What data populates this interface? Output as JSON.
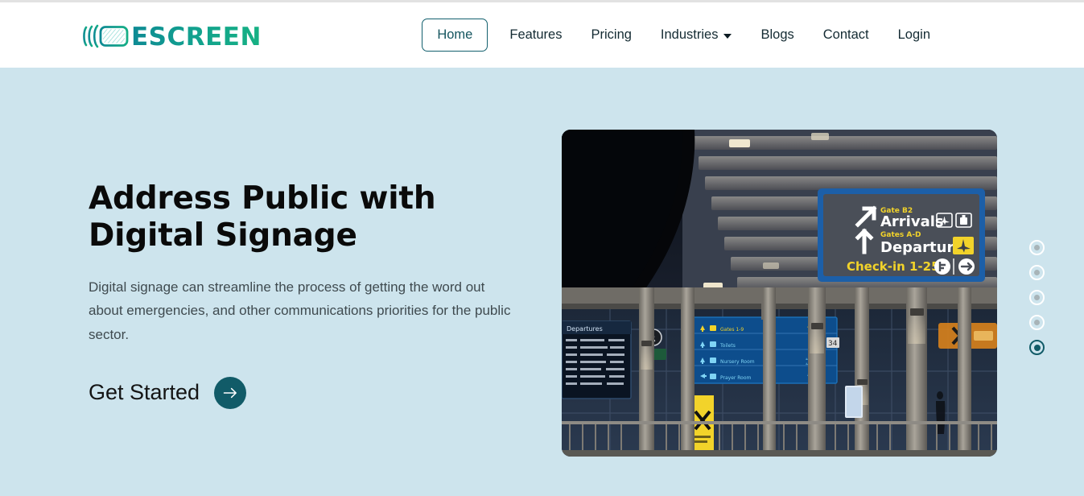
{
  "brand": {
    "name": "ESCREEN",
    "logo_icon": "screen-broadcast-icon",
    "gradient_from": "#0e8a94",
    "gradient_to": "#16b183"
  },
  "nav": {
    "items": [
      {
        "label": "Home",
        "active": true,
        "has_dropdown": false
      },
      {
        "label": "Features",
        "active": false,
        "has_dropdown": false
      },
      {
        "label": "Pricing",
        "active": false,
        "has_dropdown": false
      },
      {
        "label": "Industries",
        "active": false,
        "has_dropdown": true
      },
      {
        "label": "Blogs",
        "active": false,
        "has_dropdown": false
      },
      {
        "label": "Contact",
        "active": false,
        "has_dropdown": false
      },
      {
        "label": "Login",
        "active": false,
        "has_dropdown": false
      }
    ]
  },
  "hero": {
    "title": "Address Public with Digital Signage",
    "body": "Digital signage can streamline the process of getting the word out about emergencies, and other communications priorities for the public sector.",
    "cta_label": "Get Started",
    "cta_icon": "arrow-right-icon",
    "accent_color": "#115b68",
    "background_color": "#cde4ed"
  },
  "hero_image": {
    "alt": "Airport terminal at night with digital wayfinding signage",
    "sign": {
      "arrivals_gate": "Gate B2",
      "arrivals_label": "Arrivals",
      "departures_gate": "Gates A-D",
      "departures_label": "Departures",
      "checkin_label": "Check-in 1-25",
      "icons": [
        "plane-icon",
        "baggage-icon",
        "departure-plane-icon",
        "info-icon",
        "arrow-right-icon"
      ]
    },
    "overhead_sign": {
      "rows": [
        "Gates 1-9",
        "Toilets",
        "Nursery Room",
        "Prayer Room"
      ]
    },
    "board_label": "Departures",
    "column_number": "34"
  },
  "carousel": {
    "slides": [
      {
        "active": false
      },
      {
        "active": false
      },
      {
        "active": false
      },
      {
        "active": false
      },
      {
        "active": true
      }
    ],
    "active_index": 4
  }
}
